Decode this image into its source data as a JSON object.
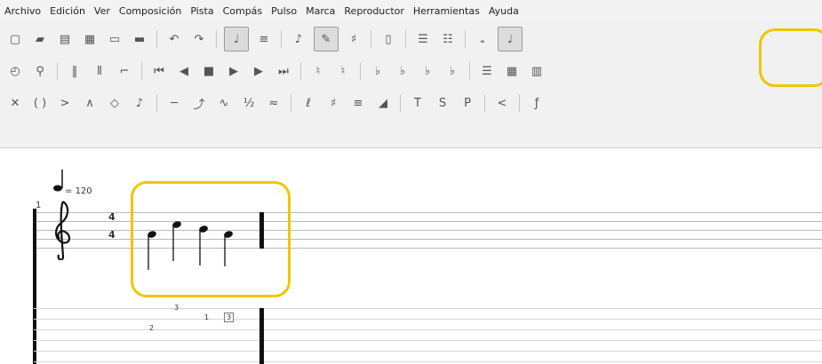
{
  "menu": [
    "Archivo",
    "Edición",
    "Ver",
    "Composición",
    "Pista",
    "Compás",
    "Pulso",
    "Marca",
    "Reproductor",
    "Herramientas",
    "Ayuda"
  ],
  "toolbar": {
    "row1": [
      "new-file-icon",
      "open-icon",
      "save-icon",
      "save-as-icon",
      "print-icon",
      "print-preview-icon",
      "sep",
      "undo-icon",
      "redo-icon",
      "sep",
      "score-view-icon",
      "tab-view-icon",
      "sep",
      "note-flag-icon",
      "pencil-icon",
      "sharp-flat-icon",
      "sep",
      "page-layout-icon",
      "sep",
      "align-left-icon",
      "align-right-icon",
      "sep",
      "whole-note-icon",
      "quarter-note-icon"
    ],
    "row2": [
      "metronome-icon",
      "tuning-icon",
      "sep",
      "repeat-open-icon",
      "repeat-close-icon",
      "alternate-ending-icon",
      "sep",
      "first-measure-icon",
      "previous-measure-icon",
      "stop-icon",
      "play-icon",
      "next-measure-icon",
      "last-measure-icon",
      "sep",
      "dynamic-ppp-icon",
      "dynamic-pp-icon",
      "sep",
      "dynamic-p-icon",
      "dynamic-mp-icon",
      "dynamic-mf-icon",
      "dynamic-f-icon",
      "sep",
      "layout-list-icon",
      "layout-grid-icon",
      "layout-columns-icon"
    ],
    "row3": [
      "dead-note-icon",
      "ghost-note-icon",
      "accent-icon",
      "heavy-accent-icon",
      "harmonic-icon",
      "grace-note-icon",
      "sep",
      "slide-icon",
      "bend-icon",
      "tremolo-bar-icon",
      "fraction-icon",
      "vibrato-icon",
      "sep",
      "trill-icon",
      "sharp-icon",
      "tremolo-picking-icon",
      "fade-in-icon",
      "sep",
      "tapping-icon",
      "slapping-icon",
      "popping-icon",
      "sep",
      "crescendo-icon",
      "sep",
      "fff-icon"
    ]
  },
  "score": {
    "measure_number": "1",
    "tempo_value": "120",
    "time_signature": {
      "top": "4",
      "bottom": "4"
    },
    "tab_frets": [
      "3",
      "2",
      "1",
      "3"
    ]
  },
  "colors": {
    "highlight": "#f2c400"
  }
}
